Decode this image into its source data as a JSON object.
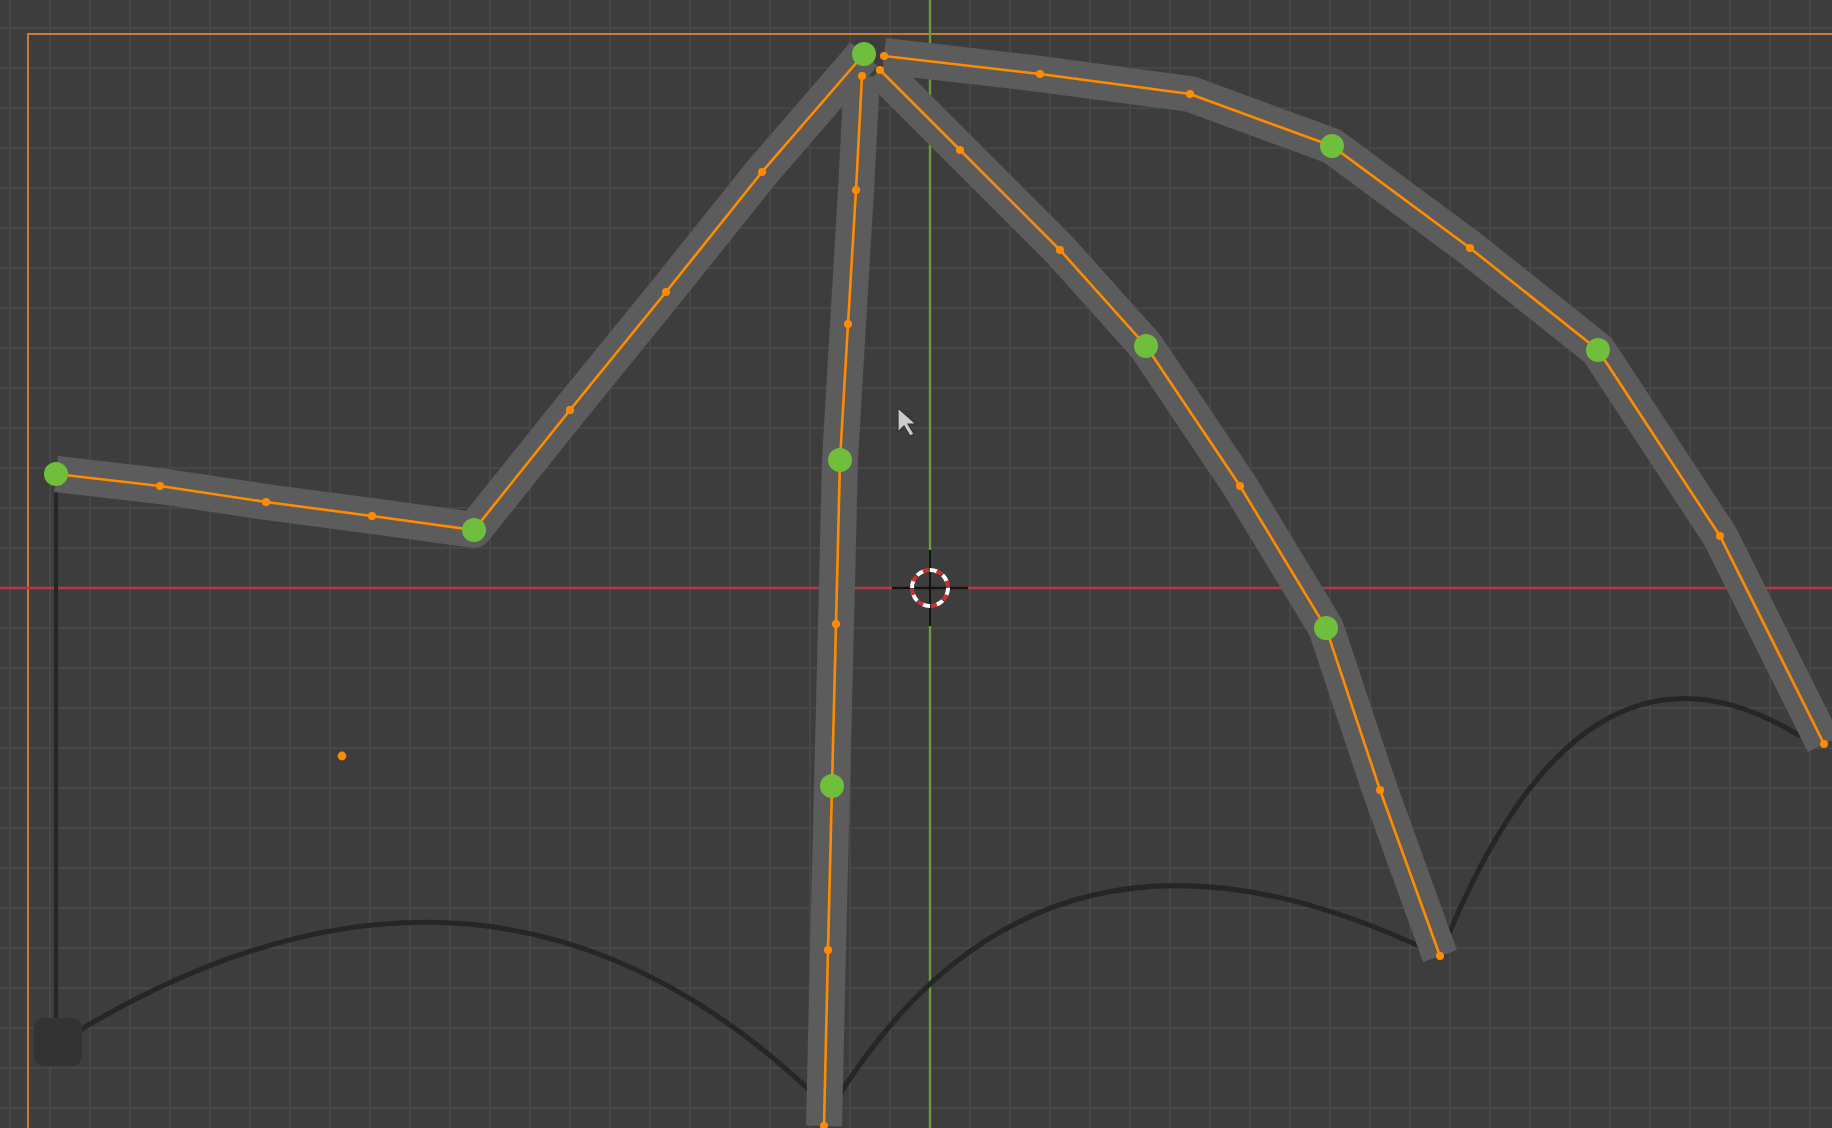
{
  "viewport": {
    "strokes": [
      {
        "kind": "polyline",
        "selected": true
      },
      {
        "kind": "polyline",
        "selected": true
      },
      {
        "kind": "polyline",
        "selected": true
      },
      {
        "kind": "polyline",
        "selected": true
      }
    ],
    "motion_path": {
      "kind": "curve"
    }
  }
}
